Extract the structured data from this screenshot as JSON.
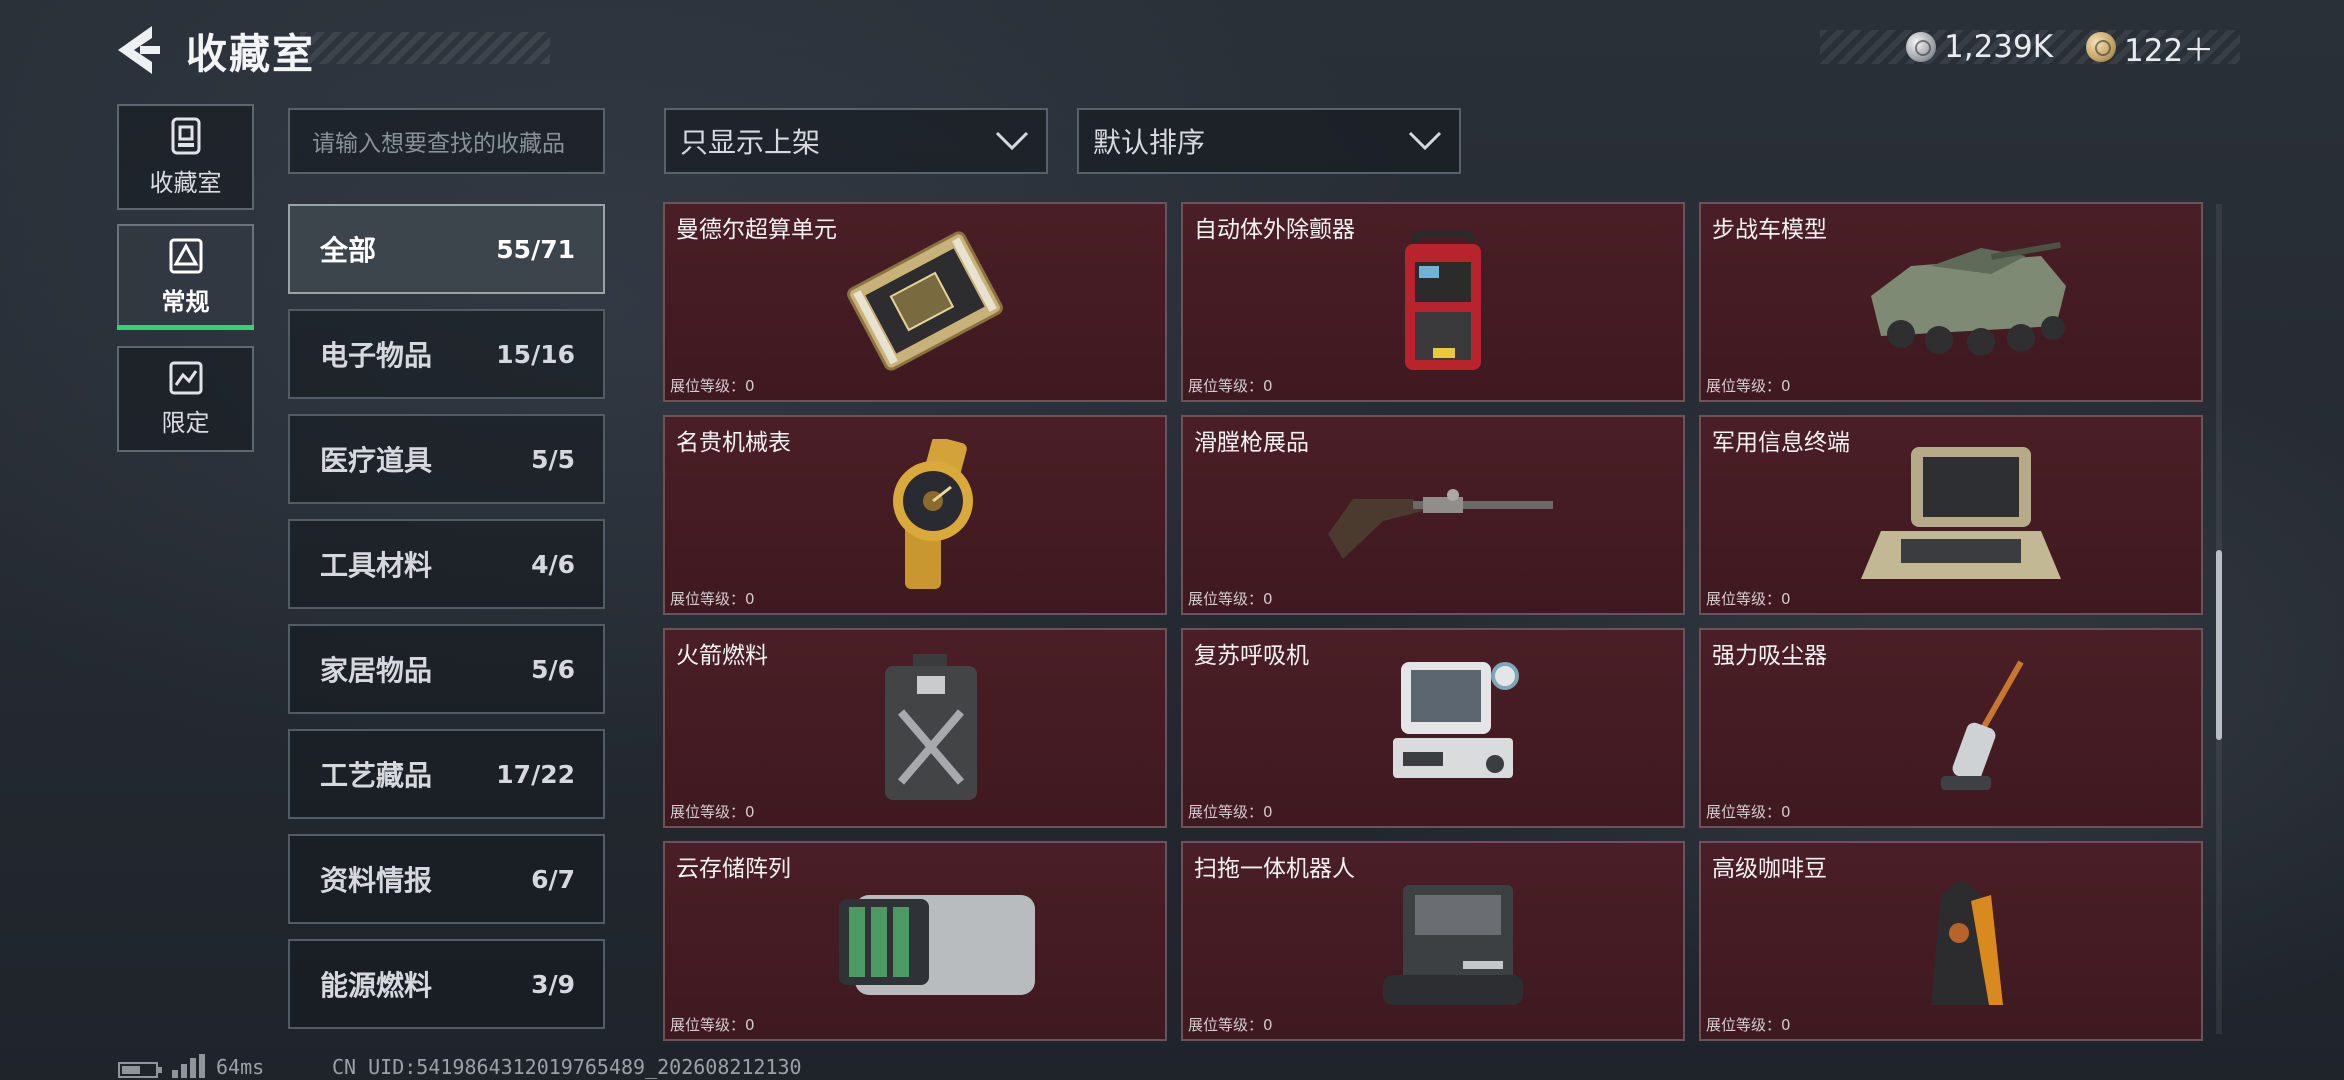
{
  "header": {
    "title": "收藏室",
    "currency_silver": "1,239K",
    "currency_gold": "122＋"
  },
  "side_nav": [
    {
      "label": "收藏室",
      "icon": "collection-room-icon"
    },
    {
      "label": "常规",
      "icon": "regular-collection-icon",
      "active": true
    },
    {
      "label": "限定",
      "icon": "limited-collection-icon"
    }
  ],
  "search": {
    "placeholder": "请输入想要查找的收藏品"
  },
  "categories": [
    {
      "name": "全部",
      "count": "55/71",
      "active": true
    },
    {
      "name": "电子物品",
      "count": "15/16"
    },
    {
      "name": "医疗道具",
      "count": "5/5"
    },
    {
      "name": "工具材料",
      "count": "4/6"
    },
    {
      "name": "家居物品",
      "count": "5/6"
    },
    {
      "name": "工艺藏品",
      "count": "17/22"
    },
    {
      "name": "资料情报",
      "count": "6/7"
    },
    {
      "name": "能源燃料",
      "count": "3/9"
    }
  ],
  "filters": {
    "shelf_filter": "只显示上架",
    "sort": "默认排序"
  },
  "items": [
    {
      "name": "曼德尔超算单元",
      "level": "展位等级：0",
      "icon": "supercomputer-board-icon"
    },
    {
      "name": "自动体外除颤器",
      "level": "展位等级：0",
      "icon": "defibrillator-icon"
    },
    {
      "name": "步战车模型",
      "level": "展位等级：0",
      "icon": "armored-vehicle-model-icon"
    },
    {
      "name": "名贵机械表",
      "level": "展位等级：0",
      "icon": "mechanical-watch-icon"
    },
    {
      "name": "滑膛枪展品",
      "level": "展位等级：0",
      "icon": "musket-icon"
    },
    {
      "name": "军用信息终端",
      "level": "展位等级：0",
      "icon": "military-terminal-icon"
    },
    {
      "name": "火箭燃料",
      "level": "展位等级：0",
      "icon": "rocket-fuel-can-icon"
    },
    {
      "name": "复苏呼吸机",
      "level": "展位等级：0",
      "icon": "ventilator-icon"
    },
    {
      "name": "强力吸尘器",
      "level": "展位等级：0",
      "icon": "vacuum-cleaner-icon"
    },
    {
      "name": "云存储阵列",
      "level": "展位等级：0",
      "icon": "storage-array-icon"
    },
    {
      "name": "扫拖一体机器人",
      "level": "展位等级：0",
      "icon": "mop-robot-icon"
    },
    {
      "name": "高级咖啡豆",
      "level": "展位等级：0",
      "icon": "coffee-beans-bag-icon"
    }
  ],
  "status": {
    "ping": "64ms",
    "uid": "CN UID:5419864312019765489_202608212130"
  },
  "colors": {
    "accent_green": "#34d17a",
    "card_bg": "#4a1e26"
  }
}
